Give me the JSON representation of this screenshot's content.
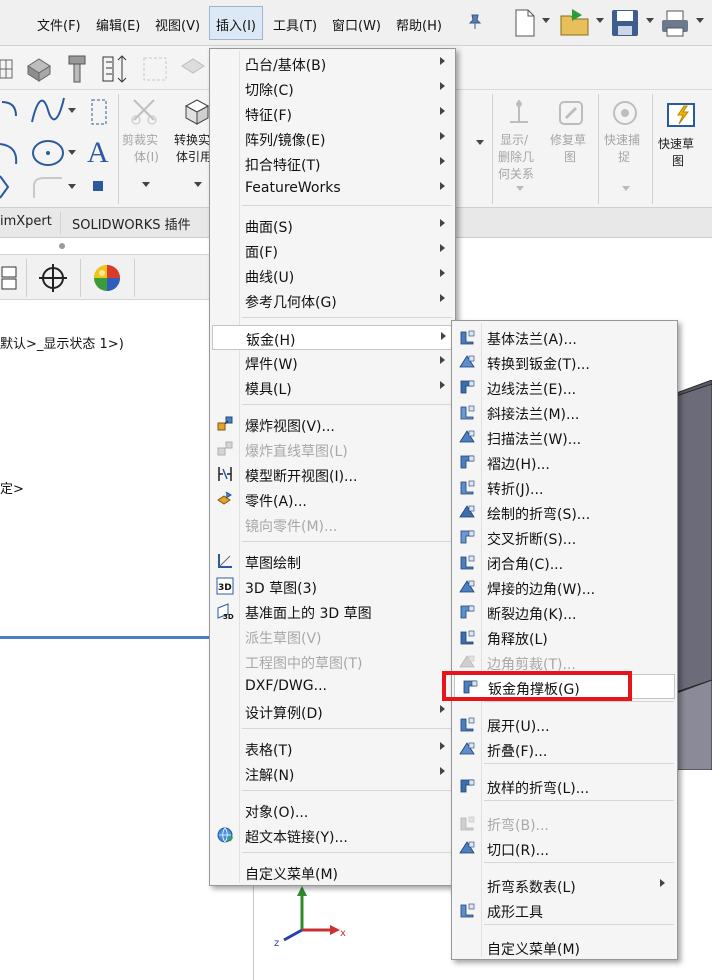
{
  "menubar": {
    "items": [
      "文件(F)",
      "编辑(E)",
      "视图(V)",
      "插入(I)",
      "工具(T)",
      "窗口(W)",
      "帮助(H)"
    ]
  },
  "ribbon": {
    "left_labels": [
      "剪裁实",
      "体(I)",
      "转换实",
      "体引用"
    ],
    "right_groups": [
      {
        "lines": [
          "显示/",
          "删除几",
          "何关系"
        ]
      },
      {
        "lines": [
          "修复草",
          "图"
        ]
      },
      {
        "lines": [
          "快速捕",
          "捉"
        ]
      },
      {
        "lines": [
          "快速草",
          "图"
        ]
      }
    ]
  },
  "tabs": {
    "t1": "imXpert",
    "t2": "SOLIDWORKS 插件"
  },
  "panel": {
    "line1": "默认>_显示状态 1>)",
    "line2": "定>"
  },
  "insert_menu": {
    "items": [
      {
        "label": "凸台/基体(B)",
        "submenu": true
      },
      {
        "label": "切除(C)",
        "submenu": true
      },
      {
        "label": "特征(F)",
        "submenu": true
      },
      {
        "label": "阵列/镜像(E)",
        "submenu": true
      },
      {
        "label": "扣合特征(T)",
        "submenu": true
      },
      {
        "label": "FeatureWorks",
        "submenu": true
      },
      {
        "label": "曲面(S)",
        "submenu": true
      },
      {
        "label": "面(F)",
        "submenu": true
      },
      {
        "label": "曲线(U)",
        "submenu": true
      },
      {
        "label": "参考几何体(G)",
        "submenu": true
      },
      {
        "label": "钣金(H)",
        "submenu": true
      },
      {
        "label": "焊件(W)",
        "submenu": true
      },
      {
        "label": "模具(L)",
        "submenu": true
      },
      {
        "label": "爆炸视图(V)...",
        "icon": "explode-view-icon"
      },
      {
        "label": "爆炸直线草图(L)",
        "disabled": true,
        "icon": "explode-line-icon"
      },
      {
        "label": "模型断开视图(I)...",
        "icon": "break-view-icon"
      },
      {
        "label": "零件(A)...",
        "icon": "part-icon"
      },
      {
        "label": "镜向零件(M)...",
        "disabled": true
      },
      {
        "label": "草图绘制",
        "icon": "sketch-icon"
      },
      {
        "label": "3D 草图(3)",
        "icon": "3d-sketch-icon"
      },
      {
        "label": "基准面上的 3D 草图",
        "icon": "3d-sketch-plane-icon"
      },
      {
        "label": "派生草图(V)",
        "disabled": true
      },
      {
        "label": "工程图中的草图(T)",
        "disabled": true
      },
      {
        "label": "DXF/DWG..."
      },
      {
        "label": "设计算例(D)",
        "submenu": true
      },
      {
        "label": "表格(T)",
        "submenu": true
      },
      {
        "label": "注解(N)",
        "submenu": true
      },
      {
        "label": "对象(O)..."
      },
      {
        "label": "超文本链接(Y)...",
        "icon": "hyperlink-icon"
      },
      {
        "label": "自定义菜单(M)"
      }
    ]
  },
  "sheetmetal_menu": {
    "items": [
      {
        "label": "基体法兰(A)..."
      },
      {
        "label": "转换到钣金(T)..."
      },
      {
        "label": "边线法兰(E)..."
      },
      {
        "label": "斜接法兰(M)..."
      },
      {
        "label": "扫描法兰(W)..."
      },
      {
        "label": "褶边(H)..."
      },
      {
        "label": "转折(J)..."
      },
      {
        "label": "绘制的折弯(S)..."
      },
      {
        "label": "交叉折断(S)..."
      },
      {
        "label": "闭合角(C)..."
      },
      {
        "label": "焊接的边角(W)..."
      },
      {
        "label": "断裂边角(K)..."
      },
      {
        "label": "角释放(L)"
      },
      {
        "label": "边角剪裁(T)...",
        "disabled": true
      },
      {
        "label": "钣金角撑板(G)",
        "highlighted": true
      },
      {
        "label": "展开(U)..."
      },
      {
        "label": "折叠(F)..."
      },
      {
        "label": "放样的折弯(L)..."
      },
      {
        "label": "折弯(B)...",
        "disabled": true
      },
      {
        "label": "切口(R)..."
      },
      {
        "label": "折弯系数表(L)",
        "submenu": true
      },
      {
        "label": "成形工具"
      },
      {
        "label": "自定义菜单(M)"
      }
    ]
  },
  "colors": {
    "highlight_border": "#e8141b",
    "accent": "#4a7fc1"
  }
}
